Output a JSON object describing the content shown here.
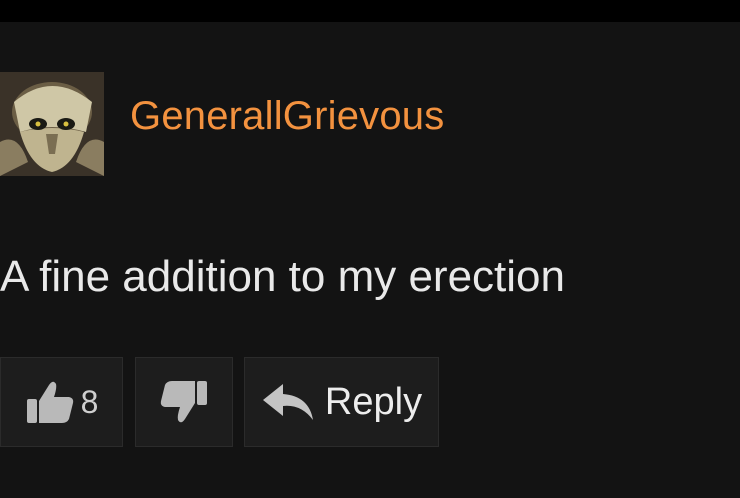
{
  "comment": {
    "username": "GenerallGrievous",
    "text": "A fine addition to my erection"
  },
  "actions": {
    "like_count": "8",
    "reply_label": "Reply"
  },
  "icons": {
    "avatar": "grievous-avatar",
    "like": "thumbs-up-icon",
    "dislike": "thumbs-down-icon",
    "reply": "reply-arrow-icon"
  },
  "colors": {
    "username": "#f3923f",
    "background": "#131313",
    "button": "#1d1d1d",
    "icon": "#b9b9b9"
  }
}
